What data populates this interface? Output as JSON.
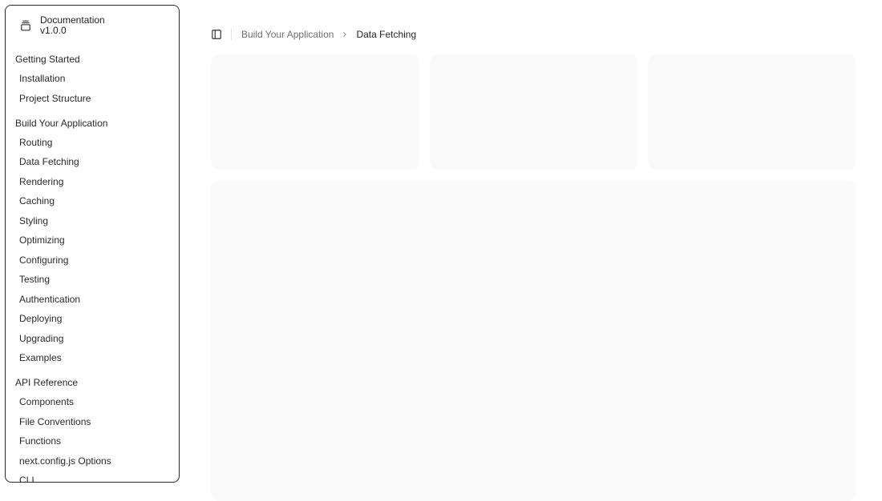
{
  "sidebar": {
    "brand": {
      "title": "Documentation",
      "version": "v1.0.0",
      "icon": "gallery-vertical-end-icon"
    },
    "groups": [
      {
        "label": "Getting Started",
        "items": [
          "Installation",
          "Project Structure"
        ]
      },
      {
        "label": "Build Your Application",
        "items": [
          "Routing",
          "Data Fetching",
          "Rendering",
          "Caching",
          "Styling",
          "Optimizing",
          "Configuring",
          "Testing",
          "Authentication",
          "Deploying",
          "Upgrading",
          "Examples"
        ]
      },
      {
        "label": "API Reference",
        "items": [
          "Components",
          "File Conventions",
          "Functions",
          "next.config.js Options",
          "CLI"
        ]
      }
    ]
  },
  "header": {
    "toggle_icon": "panel-left-icon",
    "breadcrumb": {
      "parent": "Build Your Application",
      "current": "Data Fetching"
    }
  },
  "colors": {
    "placeholder": "#fafafa",
    "sidebar_border": "#2a2a2a",
    "muted_text": "#707070"
  }
}
